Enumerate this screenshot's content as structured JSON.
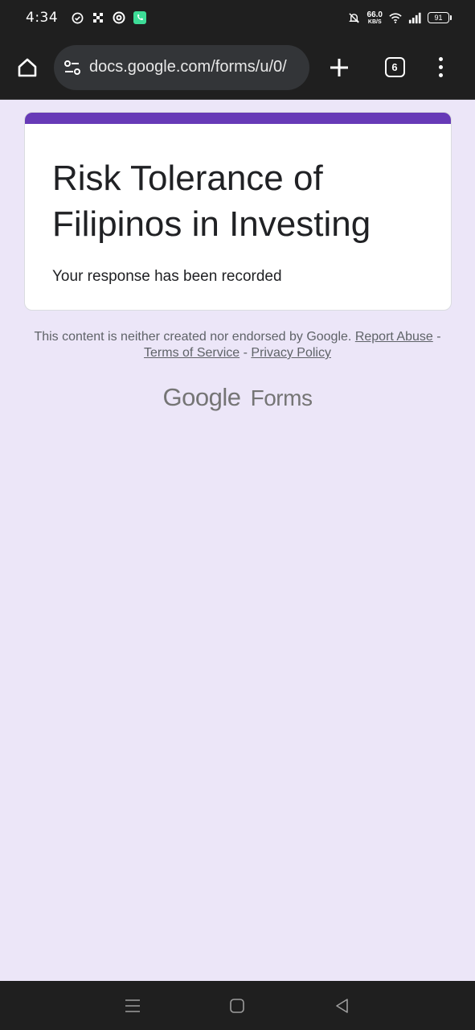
{
  "status_bar": {
    "time": "4:34",
    "net_speed_value": "66.0",
    "net_speed_unit": "KB/S",
    "battery": "91",
    "icons": [
      "check-circle-icon",
      "grid-app-icon",
      "swirl-app-icon",
      "phone-app-icon",
      "bell-off-icon",
      "wifi-icon",
      "signal-icon",
      "battery-icon"
    ]
  },
  "browser": {
    "url": "docs.google.com/forms/u/0/",
    "tab_count": "6",
    "icons": [
      "home-icon",
      "site-settings-icon",
      "new-tab-icon",
      "tab-switcher-icon",
      "menu-icon"
    ]
  },
  "form": {
    "accent_color": "#673ab7",
    "title": "Risk Tolerance of Filipinos in Investing",
    "message": "Your response has been recorded"
  },
  "footer": {
    "disclaimer": "This content is neither created nor endorsed by Google.",
    "link_report_abuse": "Report Abuse",
    "separator": " - ",
    "link_terms": "Terms of Service",
    "link_privacy": "Privacy Policy",
    "brand_google": "Google",
    "brand_forms": "Forms"
  },
  "nav_bar": {
    "icons": [
      "recents-icon",
      "home-nav-icon",
      "back-icon"
    ]
  }
}
